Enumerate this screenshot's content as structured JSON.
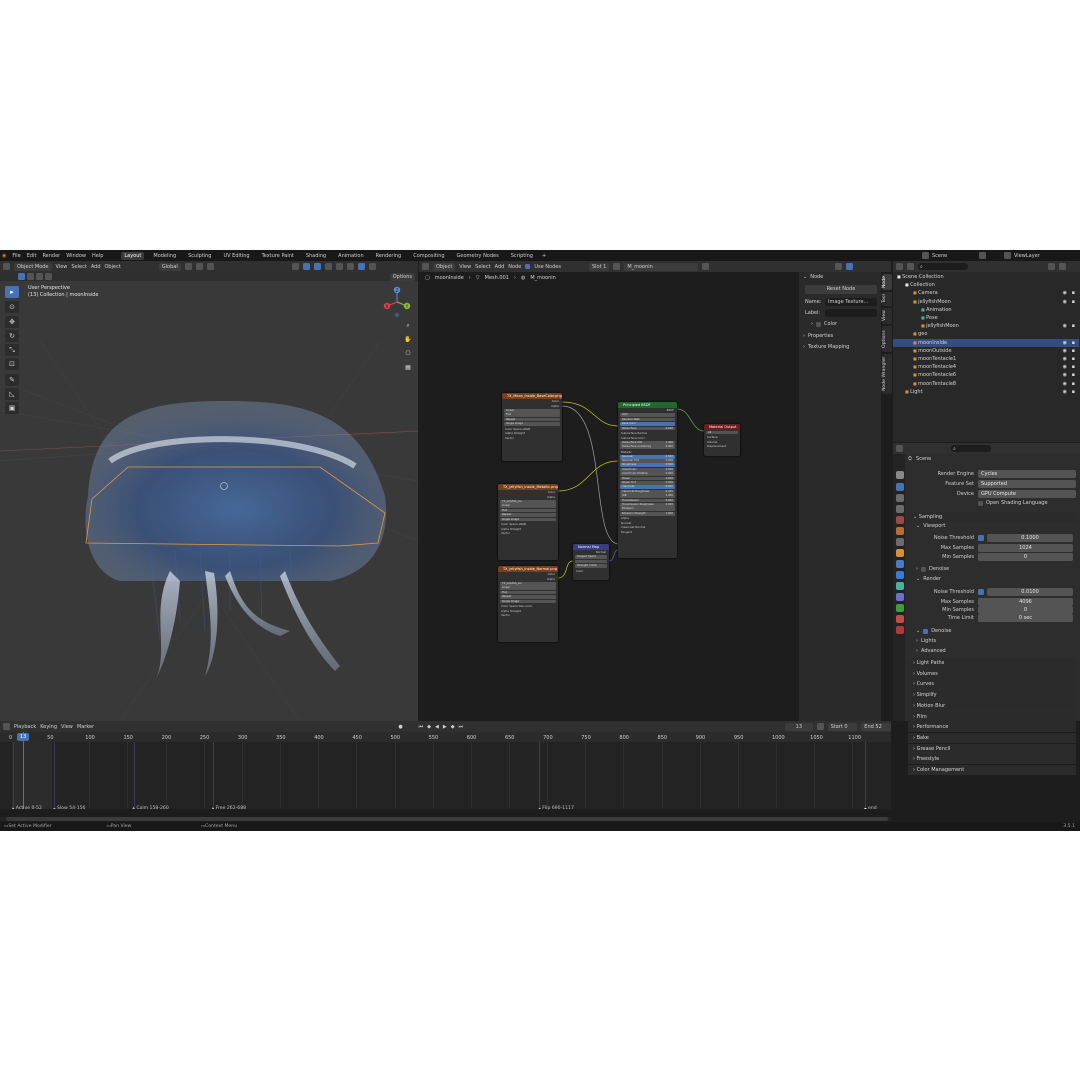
{
  "topbar": {
    "menus": [
      "File",
      "Edit",
      "Render",
      "Window",
      "Help"
    ],
    "workspaces": [
      "Layout",
      "Modeling",
      "Sculpting",
      "UV Editing",
      "Texture Paint",
      "Shading",
      "Animation",
      "Rendering",
      "Compositing",
      "Geometry Nodes",
      "Scripting"
    ],
    "add_tab": "+",
    "scene_name": "Scene",
    "view_layer": "ViewLayer"
  },
  "viewport": {
    "mode": "Object Mode",
    "menus": [
      "View",
      "Select",
      "Add",
      "Object"
    ],
    "orientation": "Global",
    "options": "Options",
    "overlay_title": "User Perspective",
    "overlay_sub": "(13) Collection | moonInside",
    "gizmo": {
      "x": "X",
      "y": "Y",
      "z": "Z"
    }
  },
  "node_editor": {
    "type": "Object",
    "menus": [
      "View",
      "Select",
      "Add",
      "Node"
    ],
    "use_nodes": "Use Nodes",
    "slot": "Slot 1",
    "material": "M_moonin",
    "breadcrumb": [
      "moonInside",
      "Mesh.001",
      "M_moonin"
    ],
    "nodes": {
      "tex1": {
        "title": "TX_Moon_Inside_BaseColor.png",
        "outputs": [
          "Color",
          "Alpha"
        ],
        "fields": [
          "Linear",
          "Flat",
          "Repeat",
          "Single Image"
        ],
        "color_space_label": "Color Space",
        "color_space": "sRGB",
        "alpha_label": "Alpha",
        "alpha": "Straight",
        "vector": "Vector"
      },
      "tex2": {
        "title": "TX_jellyfish_inside_Metallic.png",
        "outputs": [
          "Color",
          "Alpha"
        ],
        "file": "TX_jellyfish_ins",
        "fields": [
          "Linear",
          "Flat",
          "Repeat",
          "Single Image"
        ],
        "color_space_label": "Color Space",
        "color_space": "sRGB",
        "alpha_label": "Alpha",
        "alpha": "Straight",
        "vector": "Vector"
      },
      "tex3": {
        "title": "TX_jellyfish_inside_Normal.png",
        "outputs": [
          "Color",
          "Alpha"
        ],
        "file": "TX_jellyfish_ins",
        "fields": [
          "Linear",
          "Flat",
          "Repeat",
          "Single Image"
        ],
        "color_space_label": "Color Space",
        "color_space": "Non-Color",
        "alpha_label": "Alpha",
        "alpha": "Straight",
        "vector": "Vector"
      },
      "normal_map": {
        "title": "Normal Map",
        "output": "Normal",
        "space": "Tangent Space",
        "strength_label": "Strength",
        "strength": "1.000",
        "color": "Color"
      },
      "bsdf": {
        "title": "Principled BSDF",
        "output": "BSDF",
        "dist": "GGX",
        "sss": "Random Walk",
        "inputs": [
          "Base Color",
          "Subsurface",
          "Subsurface Radius",
          "Subsurface Color",
          "Subsurface IOR",
          "Subsurface Anisotropy",
          "Metallic",
          "Specular",
          "Specular Tint",
          "Roughness",
          "Anisotropic",
          "Anisotropic Rotation",
          "Sheen",
          "Sheen Tint",
          "Clearcoat",
          "Clearcoat Roughness",
          "IOR",
          "Transmission",
          "Transmission Roughness",
          "Emission",
          "Emission Strength",
          "Alpha",
          "Normal",
          "Clearcoat Normal",
          "Tangent"
        ],
        "values": [
          "",
          "0.000",
          "",
          "",
          "1.400",
          "0.000",
          "",
          "0.500",
          "0.000",
          "0.500",
          "0.000",
          "0.000",
          "0.000",
          "0.500",
          "0.000",
          "0.030",
          "1.450",
          "0.000",
          "0.000",
          "",
          "1.000",
          "",
          "",
          "",
          ""
        ]
      },
      "output": {
        "title": "Material Output",
        "target": "All",
        "inputs": [
          "Surface",
          "Volume",
          "Displacement"
        ]
      }
    }
  },
  "n_panel": {
    "section": "Node",
    "reset": "Reset Node",
    "name_label": "Name:",
    "name": "Image Texture...",
    "label_label": "Label:",
    "color": "Color",
    "properties": "Properties",
    "texture_mapping": "Texture Mapping",
    "tabs": [
      "Node",
      "Tool",
      "View",
      "Options",
      "Node Wrangler"
    ]
  },
  "outliner": {
    "items": [
      {
        "label": "Scene Collection",
        "indent": 0,
        "kind": "collection"
      },
      {
        "label": "Collection",
        "indent": 1,
        "kind": "collection"
      },
      {
        "label": "Camera",
        "indent": 2,
        "kind": "camera"
      },
      {
        "label": "jellyfishMoon",
        "indent": 2,
        "kind": "armature"
      },
      {
        "label": "Animation",
        "indent": 3,
        "kind": "anim"
      },
      {
        "label": "Pose",
        "indent": 3,
        "kind": "pose"
      },
      {
        "label": "jellyfishMoon",
        "indent": 3,
        "kind": "armature"
      },
      {
        "label": "geo",
        "indent": 2,
        "kind": "empty"
      },
      {
        "label": "moonInside",
        "indent": 2,
        "kind": "mesh",
        "selected": true
      },
      {
        "label": "moonOutside",
        "indent": 2,
        "kind": "mesh"
      },
      {
        "label": "moonTentacle1",
        "indent": 2,
        "kind": "mesh"
      },
      {
        "label": "moonTentacle4",
        "indent": 2,
        "kind": "mesh"
      },
      {
        "label": "moonTentacle6",
        "indent": 2,
        "kind": "mesh"
      },
      {
        "label": "moonTentacle8",
        "indent": 2,
        "kind": "mesh"
      },
      {
        "label": "Light",
        "indent": 1,
        "kind": "light"
      }
    ]
  },
  "properties": {
    "scene": "Scene",
    "render_engine_label": "Render Engine",
    "render_engine": "Cycles",
    "feature_set_label": "Feature Set",
    "feature_set": "Supported",
    "device_label": "Device",
    "device": "GPU Compute",
    "osl": "Open Shading Language",
    "sampling": "Sampling",
    "viewport": "Viewport",
    "render": "Render",
    "noise_threshold_label": "Noise Threshold",
    "max_samples_label": "Max Samples",
    "min_samples_label": "Min Samples",
    "time_limit_label": "Time Limit",
    "vp_noise": "0.1000",
    "vp_max": "1024",
    "vp_min": "0",
    "r_noise": "0.0100",
    "r_max": "4096",
    "r_min": "0",
    "r_time": "0 sec",
    "denoise": "Denoise",
    "lights": "Lights",
    "advanced": "Advanced",
    "sections": [
      "Light Paths",
      "Volumes",
      "Curves",
      "Simplify",
      "Motion Blur",
      "Film",
      "Performance",
      "Bake",
      "Grease Pencil",
      "Freestyle",
      "Color Management"
    ]
  },
  "timeline": {
    "menus": [
      "Playback",
      "Keying",
      "View",
      "Marker"
    ],
    "current_frame": "13",
    "start_label": "Start",
    "start": "0",
    "end_label": "End",
    "end": "52",
    "frames": [
      "0",
      "50",
      "100",
      "150",
      "200",
      "250",
      "300",
      "350",
      "400",
      "450",
      "500",
      "550",
      "600",
      "650",
      "700",
      "750",
      "800",
      "850",
      "900",
      "950",
      "1000",
      "1050",
      "1100"
    ],
    "markers": [
      "Active 0-52",
      "Slow 54-156",
      "Calm 158-260",
      "Free 262-688",
      "Flip 690-1117",
      "end"
    ]
  },
  "statusbar": {
    "items": [
      "Set Active Modifier",
      "Pan View",
      "Context Menu"
    ],
    "version": "3.5.1"
  }
}
